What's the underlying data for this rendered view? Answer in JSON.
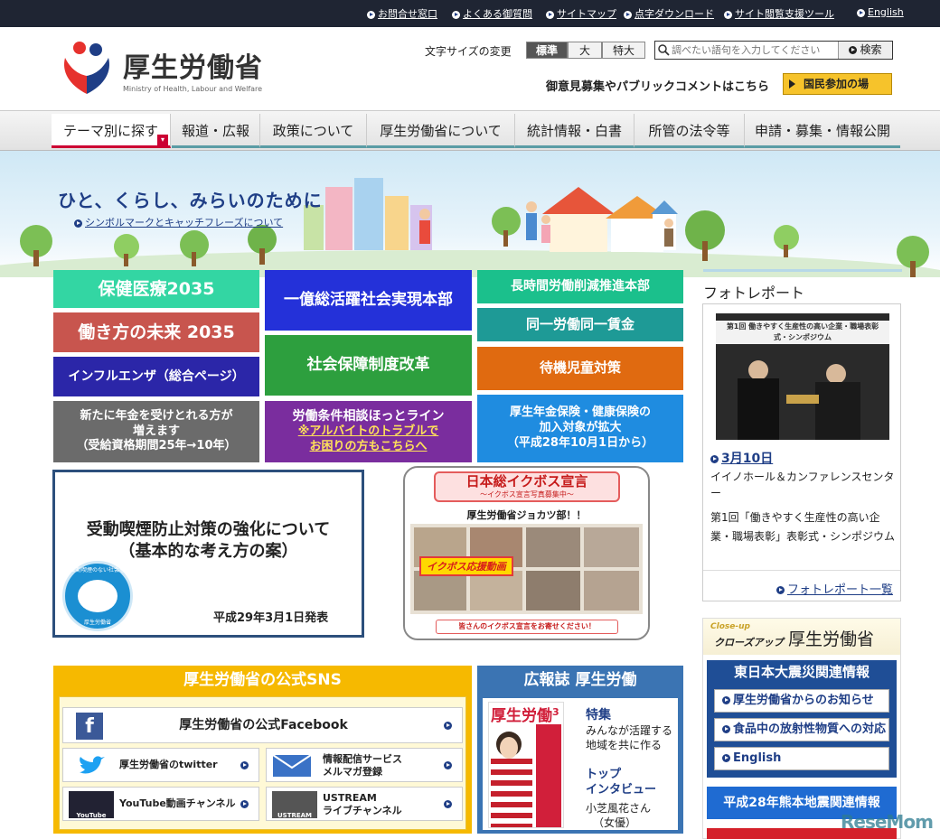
{
  "topbar": {
    "links": [
      "お問合せ窓口",
      "よくある御質問",
      "サイトマップ",
      "点字ダウンロード",
      "サイト閲覧支援ツール",
      "English"
    ]
  },
  "header": {
    "logo_jp": "厚生労働省",
    "logo_en": "Ministry of Health, Labour and Welfare",
    "font_size_label": "文字サイズの変更",
    "font_sizes": [
      "標準",
      "大",
      "特大"
    ],
    "search_placeholder": "調べたい語句を入力してください",
    "search_button": "検索",
    "opinion_text": "御意見募集やパブリックコメントはこちら",
    "kokumin_button": "国民参加の場"
  },
  "nav": {
    "items": [
      "テーマ別に探す",
      "報道・広報",
      "政策について",
      "厚生労働省について",
      "統計情報・白書",
      "所管の法令等",
      "申請・募集・情報公開"
    ]
  },
  "hero": {
    "tagline": "ひと、くらし、みらいのために",
    "symbol_link": "シンボルマークとキャッチフレーズについて"
  },
  "tiles": {
    "hoken": "保健医療2035",
    "hatarakikata": "働き方の未来 2035",
    "influenza": "インフルエンザ（総合ページ）",
    "nenkin": [
      "新たに年金を受けとれる方が",
      "増えます",
      "（受給資格期間25年→10年）"
    ],
    "ichioku": "一億総活躍社会実現本部",
    "shakai": "社会保障制度改革",
    "roudou_title": "労働条件相談ほっとライン",
    "roudou_sub": [
      "※アルバイトのトラブルで",
      "お困りの方もこちらへ"
    ],
    "choujikan": "長時間労働削減推進本部",
    "douitsu": "同一労働同一賃金",
    "taiki": "待機児童対策",
    "kousei_nenkin": [
      "厚生年金保険・健康保険の",
      "加入対象が拡大",
      "（平成28年10月1日から）"
    ]
  },
  "smoke": {
    "title": [
      "受動喫煙防止対策の強化について",
      "（基本的な考え方の案）"
    ],
    "date": "平成29年3月1日発表",
    "badge_top": "受動喫煙のない社会を",
    "badge_bottom": "厚生労働省"
  },
  "ikuboss": {
    "title": "日本総イクボス宣言",
    "subtitle": "〜イクボス宣言写真募集中〜",
    "team": "厚生労働省ジョカツ部！！",
    "banner": "イクボス応援動画",
    "footer": "皆さんのイクボス宣言をお寄せください！"
  },
  "sns": {
    "title": "厚生労働省の公式SNS",
    "facebook": "厚生労働省の公式Facebook",
    "twitter": "厚生労働省のtwitter",
    "mail": [
      "情報配信サービス",
      "メルマガ登録"
    ],
    "youtube": "YouTube動画チャンネル",
    "ustream": [
      "USTREAM",
      "ライブチャンネル"
    ],
    "youtube_logo": "YouTube",
    "ustream_logo": "USTREAM"
  },
  "kouhou": {
    "title": "広報誌 厚生労働",
    "cover_title": "厚生労働",
    "cover_issue": "3",
    "tokushu": "特集",
    "tokushu_text": [
      "みんなが活躍する",
      "地域を共に作る"
    ],
    "interview": [
      "トップ",
      "インタビュー"
    ],
    "guest": [
      "小芝風花さん",
      "（女優）"
    ]
  },
  "photo": {
    "heading": "フォトレポート",
    "date": "3月10日",
    "venue": "イイノホール＆カンファレンスセンター",
    "desc": "第1回「働きやすく生産性の高い企業・職場表彰」表彰式・シンポジウム",
    "more": "フォトレポート一覧",
    "banner_text": "第1回 働きやすく生産性の高い企業・職場表彰式・シンポジウム"
  },
  "closeup": {
    "small": "Close-up",
    "label": "クローズアップ",
    "title": "厚生労働省",
    "section1": "東日本大震災関連情報",
    "links": [
      "厚生労働省からのお知らせ",
      "食品中の放射性物質への対応",
      "English"
    ],
    "section2": "平成28年熊本地震関連情報"
  },
  "watermark": "ReseMom",
  "colors": {
    "nav_active": "#cc0033",
    "brand_blue": "#1f3e86",
    "sns_yellow": "#f6b900",
    "kouhou_blue": "#3b74b3"
  }
}
